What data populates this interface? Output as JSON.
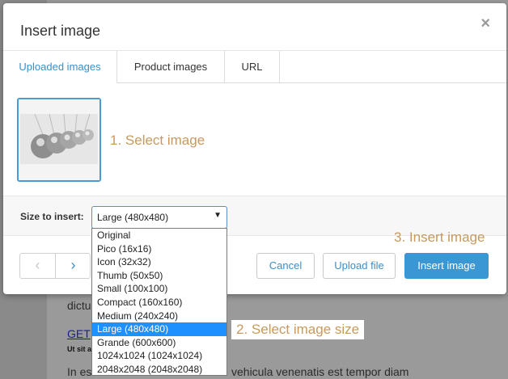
{
  "background": {
    "text_dictu": "dictu",
    "link_get": "GET",
    "bold_ut": "Ut sit a",
    "paragraph": "In es",
    "paragraph_tail": "vehicula venenatis est tempor diam",
    "colon": ":"
  },
  "modal": {
    "title": "Insert image",
    "close_label": "×",
    "tabs": [
      {
        "label": "Uploaded images",
        "active": true
      },
      {
        "label": "Product images",
        "active": false
      },
      {
        "label": "URL",
        "active": false
      }
    ],
    "step1_hint": "1. Select image",
    "size_label": "Size to insert:",
    "size_selected": "Large (480x480)",
    "size_arrow": "▼",
    "size_options": [
      "Original",
      "Pico (16x16)",
      "Icon (32x32)",
      "Thumb (50x50)",
      "Small (100x100)",
      "Compact (160x160)",
      "Medium (240x240)",
      "Large (480x480)",
      "Grande (600x600)",
      "1024x1024 (1024x1024)",
      "2048x2048 (2048x2048)"
    ],
    "selected_option_index": 7,
    "step2_hint": "2. Select image size",
    "step3_hint": "3. Insert image",
    "nav_prev": "‹",
    "nav_next": "›",
    "buttons": {
      "cancel": "Cancel",
      "upload": "Upload file",
      "insert": "Insert image"
    }
  },
  "colors": {
    "accent": "#3b97d3",
    "hint": "#c7995e",
    "selected_option": "#1e90ff"
  }
}
